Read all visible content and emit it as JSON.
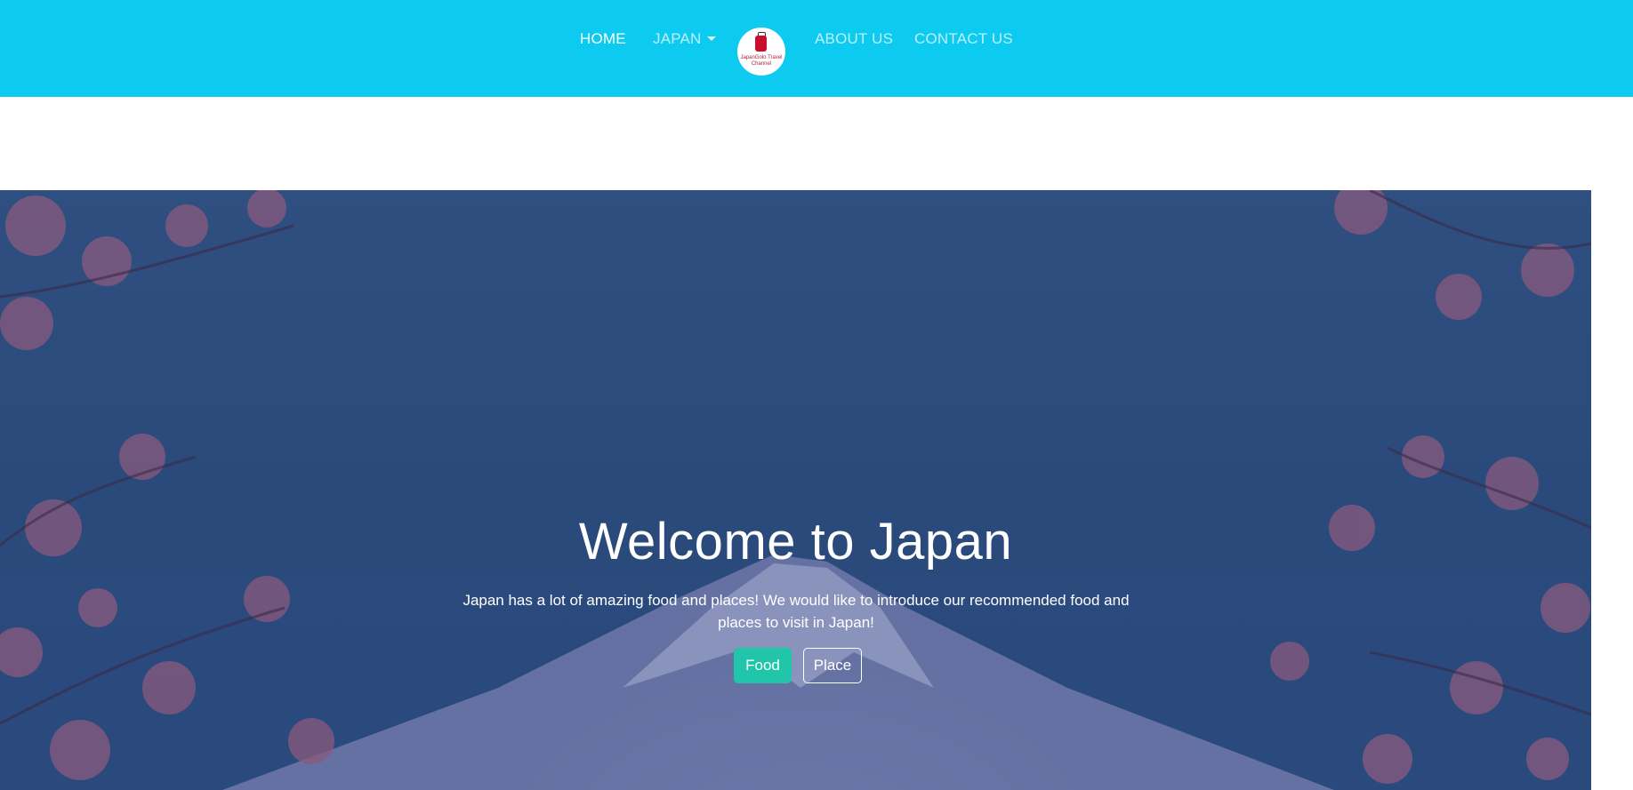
{
  "navbar": {
    "background": "#0dcaf0",
    "links": {
      "home": "HOME",
      "japan": "JAPAN",
      "about": "ABOUT US",
      "contact": "CONTACT US"
    },
    "logo": {
      "icon": "suitcase-icon",
      "text": "JapanGolo Travel Channel"
    }
  },
  "hero": {
    "title": "Welcome to Japan",
    "description": "Japan has a lot of amazing food and places! We would like to introduce our recommended food and places to visit in Japan!",
    "buttons": {
      "food": "Food",
      "place": "Place"
    },
    "accent": "#20c5aa"
  }
}
